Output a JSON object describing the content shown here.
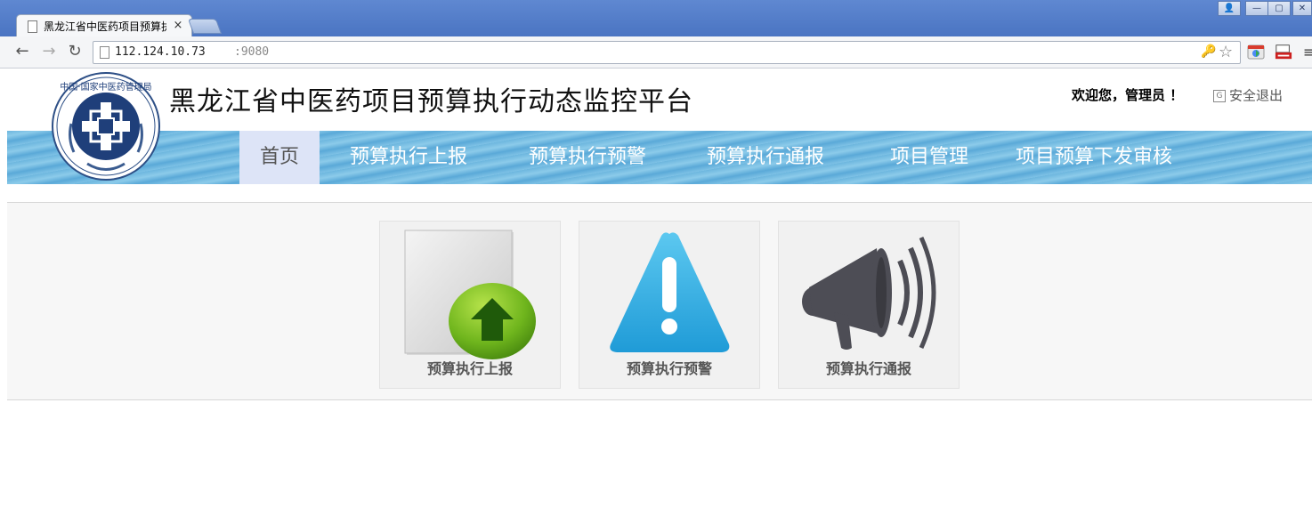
{
  "browser": {
    "tab": {
      "title": "黑龙江省中医药项目预算执",
      "close_glyph": "×"
    },
    "window_controls": [
      "👤",
      "—",
      "▢",
      "✕"
    ],
    "nav": {
      "back": "←",
      "forward": "→",
      "reload": "↻"
    },
    "address": {
      "host": "112.124.10.73",
      "port": ":9080"
    },
    "icons": {
      "key": "🔑",
      "star": "☆",
      "menu": "≡"
    },
    "extensions": [
      "chrome-webstore-icon",
      "ie-tab-icon"
    ]
  },
  "header": {
    "logo_text": "中国·国家中医药管理局",
    "title": "黑龙江省中医药项目预算执行动态监控平台",
    "welcome": "欢迎您，管理员 ！",
    "logout_icon_glyph": "G",
    "logout_label": "安全退出"
  },
  "nav": {
    "items": [
      {
        "label": "首页",
        "active": true
      },
      {
        "label": "预算执行上报"
      },
      {
        "label": "预算执行预警"
      },
      {
        "label": "预算执行通报"
      },
      {
        "label": "项目管理"
      },
      {
        "label": "项目预算下发审核"
      }
    ]
  },
  "cards": [
    {
      "label": "预算执行上报",
      "icon": "upload-icon"
    },
    {
      "label": "预算执行预警",
      "icon": "warning-icon"
    },
    {
      "label": "预算执行通报",
      "icon": "megaphone-icon"
    }
  ],
  "colors": {
    "accent_blue": "#6cb6de",
    "active_tab": "#dde4f7",
    "upload_green": "#58a618",
    "warning_blue": "#2aa8dd",
    "megaphone_gray": "#4d4d55"
  }
}
